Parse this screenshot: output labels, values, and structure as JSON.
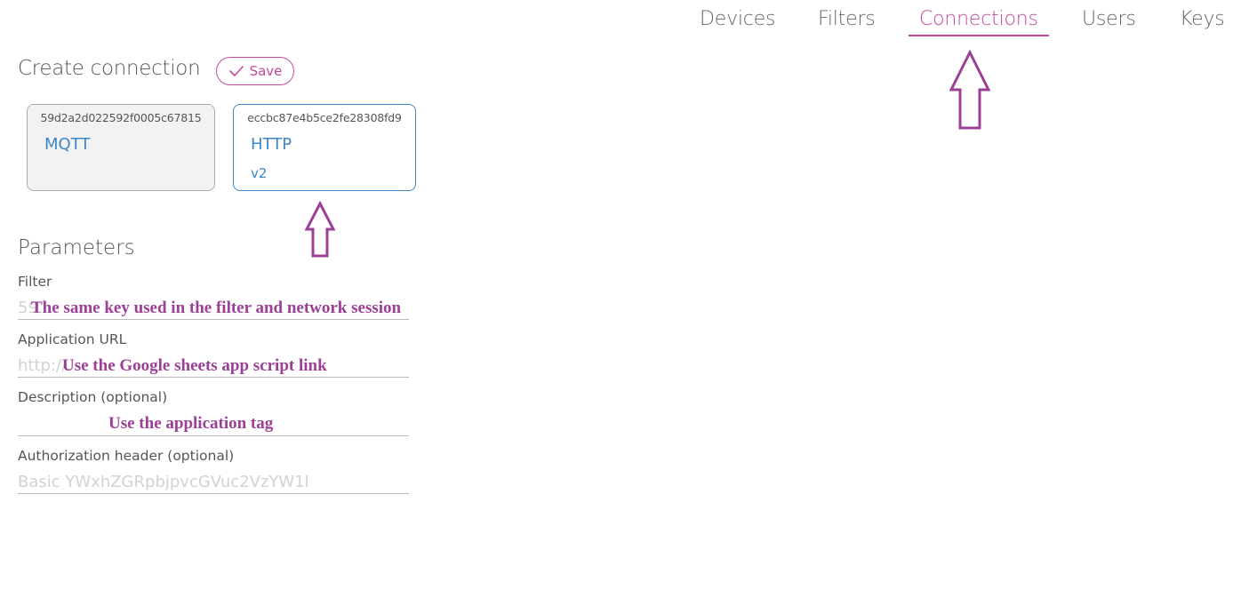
{
  "nav": {
    "items": [
      {
        "label": "Devices",
        "active": false
      },
      {
        "label": "Filters",
        "active": false
      },
      {
        "label": "Connections",
        "active": true
      },
      {
        "label": "Users",
        "active": false
      },
      {
        "label": "Keys",
        "active": false
      }
    ],
    "accent_color": "#c24a9b"
  },
  "header": {
    "title": "Create connection",
    "save_label": "Save",
    "save_icon": "check-icon"
  },
  "cards": [
    {
      "id": "59d2a2d022592f0005c67815",
      "name": "MQTT",
      "version": "",
      "selected": false
    },
    {
      "id": "eccbc87e4b5ce2fe28308fd9",
      "name": "HTTP",
      "version": "v2",
      "selected": true
    }
  ],
  "parameters": {
    "title": "Parameters",
    "fields": [
      {
        "label": "Filter",
        "placeholder": "59...",
        "value": ""
      },
      {
        "label": "Application URL",
        "placeholder": "http://",
        "value": ""
      },
      {
        "label": "Description (optional)",
        "placeholder": "",
        "value": ""
      },
      {
        "label": "Authorization header (optional)",
        "placeholder": "Basic YWxhZGRpbjpvcGVuc2VzYW1l",
        "value": ""
      }
    ]
  },
  "annotations": {
    "filter_note": "The same key used in the filter and network session",
    "url_note": "Use the Google sheets app script link",
    "description_note": "Use the application tag",
    "arrow_color": "#9b3f97"
  }
}
